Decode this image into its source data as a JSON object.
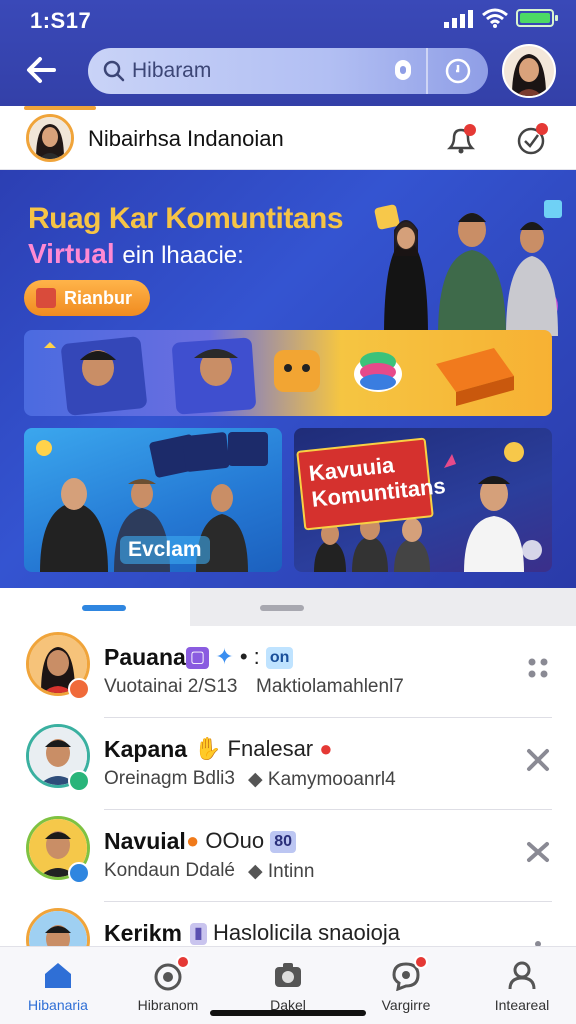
{
  "status_bar": {
    "time": "1:S17"
  },
  "header": {
    "search_text": "Hibaram",
    "avatar_icon": "user-avatar"
  },
  "community": {
    "title": "Nibairhsa Indanoian"
  },
  "banner": {
    "headline": "Ruag Kar Komuntitans",
    "subline_a": "Virtual",
    "subline_b": "ein lhaacie:",
    "cta_label": "Rianbur",
    "card3_label": "Evclam",
    "card4_label_1": "Kavuuia",
    "card4_label_2": "Komuntitans"
  },
  "feed": {
    "items": [
      {
        "name": "Pauana",
        "tail": "• :",
        "badge": "on",
        "meta_a": "Vuotainai 2/S13",
        "meta_b": "Maktiolamahlenl7",
        "badge_color": "orange"
      },
      {
        "name": "Kapana",
        "tail": "Fnalesar",
        "meta_a": "Oreinagm Bdli3",
        "meta_b": "Kamymooanrl4",
        "badge_color": "green"
      },
      {
        "name": "Navuial",
        "tail": "OOuo",
        "badge": "80",
        "meta_a": "Kondaun Ddalé",
        "meta_b": "Intinn",
        "badge_color": "blue"
      },
      {
        "name": "Kerikm",
        "tail": "Haslolicila snaoioja",
        "meta_a": "",
        "meta_b": "",
        "badge_color": "orange"
      }
    ]
  },
  "bottom_nav": {
    "items": [
      {
        "label": "Hibanaria",
        "icon": "home-icon"
      },
      {
        "label": "Hibranom",
        "icon": "activity-icon"
      },
      {
        "label": "Dakel",
        "icon": "camera-icon"
      },
      {
        "label": "Vargirre",
        "icon": "chat-icon"
      },
      {
        "label": "Inteareal",
        "icon": "profile-icon"
      }
    ]
  },
  "colors": {
    "header_bg": "#3a49b8",
    "accent": "#2f86e0",
    "highlight": "#f0a43a",
    "notification": "#e53935"
  }
}
